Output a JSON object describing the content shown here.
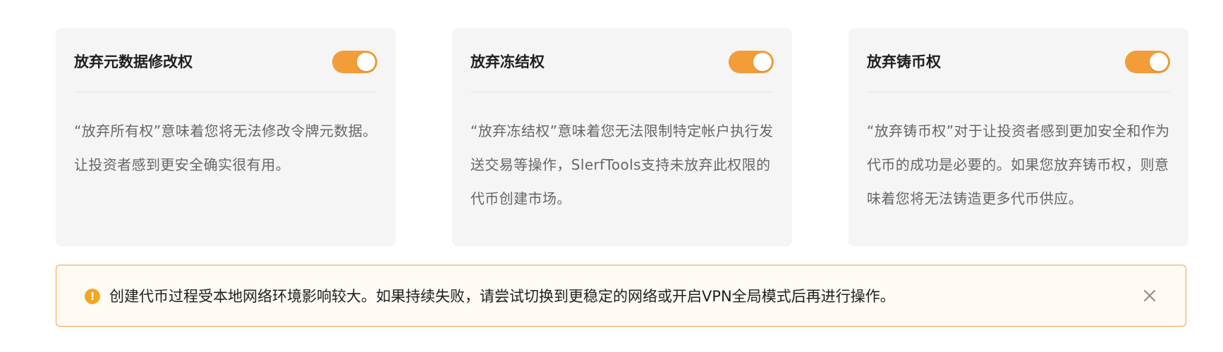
{
  "cards": [
    {
      "title": "放弃元数据修改权",
      "toggle_on": true,
      "description": "“放弃所有权”意味着您将无法修改令牌元数据。让投资者感到更安全确实很有用。"
    },
    {
      "title": "放弃冻结权",
      "toggle_on": true,
      "description": "“放弃冻结权”意味着您无法限制特定帐户执行发送交易等操作，SlerfTools支持未放弃此权限的代币创建市场。"
    },
    {
      "title": "放弃铸币权",
      "toggle_on": true,
      "description": "“放弃铸币权”对于让投资者感到更加安全和作为代币的成功是必要的。如果您放弃铸币权，则意味着您将无法铸造更多代币供应。"
    }
  ],
  "alert": {
    "icon": "exclamation-circle-icon",
    "icon_glyph": "!",
    "message": "创建代币过程受本地网络环境影响较大。如果持续失败，请尝试切换到更稳定的网络或开启VPN全局模式后再进行操作。",
    "close_icon": "close-icon"
  },
  "colors": {
    "accent": "#f29d38",
    "card_bg": "#f5f5f5",
    "alert_bg": "#fffaf3",
    "alert_border": "#f0a34a",
    "warning_icon": "#f5a623"
  }
}
